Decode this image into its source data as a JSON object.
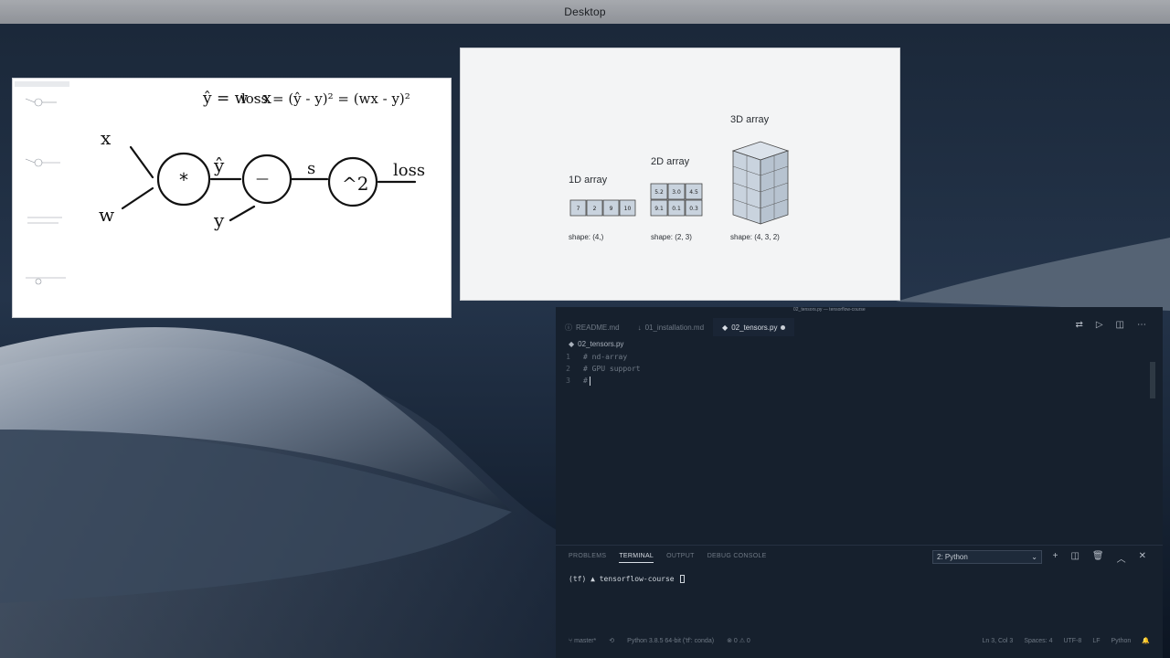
{
  "desktop": {
    "title": "Desktop",
    "colors": {
      "wallpaper_dark": "#0e1827",
      "wallpaper_light": "#a6aeb8"
    }
  },
  "whiteboard": {
    "equation1": "ŷ = w · x",
    "equation2": "loss = (ŷ - y)² = (wx - y)²",
    "labels": {
      "x": "x",
      "w": "w",
      "y": "y",
      "yhat": "ŷ",
      "s": "s",
      "loss": "loss",
      "mult": "*",
      "minus": "—",
      "square": "^2"
    }
  },
  "tensor_figure": {
    "arrays": [
      {
        "label": "1D array",
        "shape": "shape: (4,)"
      },
      {
        "label": "2D array",
        "shape": "shape: (2, 3)"
      },
      {
        "label": "3D array",
        "shape": "shape: (4, 3, 2)"
      }
    ],
    "cells_1d": [
      "7",
      "2",
      "9",
      "10"
    ],
    "cells_2d": [
      "5.2",
      "3.0",
      "4.5",
      "9.1",
      "0.1",
      "0.3"
    ]
  },
  "vscode": {
    "window_title": "02_tensors.py — tensorflow-course",
    "tabs": [
      {
        "icon": "ⓘ",
        "label": "README.md",
        "active": false
      },
      {
        "icon": "↓",
        "label": "01_installation.md",
        "active": false
      },
      {
        "icon": "◆",
        "label": "02_tensors.py",
        "active": true
      }
    ],
    "breadcrumb": "02_tensors.py",
    "code": [
      {
        "n": "1",
        "text": "# nd-array"
      },
      {
        "n": "2",
        "text": "# GPU support"
      },
      {
        "n": "3",
        "text": "# "
      }
    ],
    "panel_tabs": [
      "PROBLEMS",
      "TERMINAL",
      "OUTPUT",
      "DEBUG CONSOLE"
    ],
    "panel_active": "TERMINAL",
    "terminal_select": "2: Python",
    "terminal_prompt": "(tf) ▲ tensorflow-course",
    "status": {
      "branch": "master*",
      "interpreter": "Python 3.8.5 64-bit ('tf': conda)",
      "problems": "⊗ 0 ⚠ 0",
      "position": "Ln 3, Col 3",
      "spaces": "Spaces: 4",
      "encoding": "UTF-8",
      "eol": "LF",
      "language": "Python"
    }
  }
}
